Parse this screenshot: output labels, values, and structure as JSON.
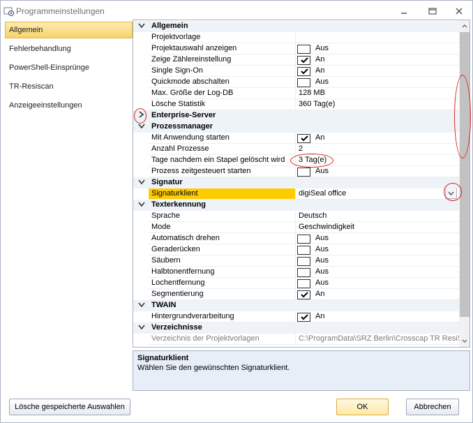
{
  "window": {
    "title": "Programmeinstellungen",
    "minimize_icon": "minimize-icon",
    "maximize_icon": "maximize-icon",
    "close_icon": "close-icon"
  },
  "nav": {
    "items": [
      {
        "label": "Allgemein",
        "active": true
      },
      {
        "label": "Fehlerbehandlung",
        "active": false
      },
      {
        "label": "PowerShell-Einsprünge",
        "active": false
      },
      {
        "label": "TR-Resiscan",
        "active": false
      },
      {
        "label": "Anzeigeeinstellungen",
        "active": false
      }
    ]
  },
  "grid": {
    "rows": [
      {
        "type": "cat",
        "label": "Allgemein",
        "expanded": true
      },
      {
        "type": "text",
        "name": "Projektvorlage",
        "value": ""
      },
      {
        "type": "check",
        "name": "Projektauswahl anzeigen",
        "checked": false,
        "value": "Aus"
      },
      {
        "type": "check",
        "name": "Zeige Zählereinstellung",
        "checked": true,
        "value": "An"
      },
      {
        "type": "check",
        "name": "Single Sign-On",
        "checked": true,
        "value": "An"
      },
      {
        "type": "check",
        "name": "Quickmode abschalten",
        "checked": false,
        "value": "Aus"
      },
      {
        "type": "text",
        "name": "Max. Größe der Log-DB",
        "value": "128 MB"
      },
      {
        "type": "text",
        "name": "Lösche Statistik",
        "value": "360 Tag(e)"
      },
      {
        "type": "cat",
        "label": "Enterprise-Server",
        "expanded": false
      },
      {
        "type": "cat",
        "label": "Prozessmanager",
        "expanded": true
      },
      {
        "type": "check",
        "name": "Mit Anwendung starten",
        "checked": true,
        "value": "An"
      },
      {
        "type": "text",
        "name": "Anzahl Prozesse",
        "value": "2"
      },
      {
        "type": "text",
        "name": "Tage nachdem ein Stapel gelöscht wird",
        "value": "3 Tag(e)"
      },
      {
        "type": "check",
        "name": "Prozess zeitgesteuert starten",
        "checked": false,
        "value": "Aus"
      },
      {
        "type": "cat",
        "label": "Signatur",
        "expanded": true
      },
      {
        "type": "dropdown",
        "name": "Signaturklient",
        "value": "digiSeal office",
        "selected": true
      },
      {
        "type": "cat",
        "label": "Texterkennung",
        "expanded": true
      },
      {
        "type": "text",
        "name": "Sprache",
        "value": "Deutsch"
      },
      {
        "type": "text",
        "name": "Mode",
        "value": "Geschwindigkeit"
      },
      {
        "type": "check",
        "name": "Automatisch drehen",
        "checked": false,
        "value": "Aus"
      },
      {
        "type": "check",
        "name": "Geraderücken",
        "checked": false,
        "value": "Aus"
      },
      {
        "type": "check",
        "name": "Säubern",
        "checked": false,
        "value": "Aus"
      },
      {
        "type": "check",
        "name": "Halbtonentfernung",
        "checked": false,
        "value": "Aus"
      },
      {
        "type": "check",
        "name": "Lochentfernung",
        "checked": false,
        "value": "Aus"
      },
      {
        "type": "check",
        "name": "Segmentierung",
        "checked": true,
        "value": "An"
      },
      {
        "type": "cat",
        "label": "TWAIN",
        "expanded": true
      },
      {
        "type": "check",
        "name": "Hintergrundverarbeitung",
        "checked": true,
        "value": "An"
      },
      {
        "type": "cat",
        "label": "Verzeichnisse",
        "expanded": true
      },
      {
        "type": "text",
        "name": "Verzeichnis der Projektvorlagen",
        "value": "C:\\ProgramData\\SRZ Berlin\\Crosscap TR ResiS",
        "disabled": true
      }
    ]
  },
  "help": {
    "title": "Signaturklient",
    "description": "Wählen Sie den gewünschten Signaturklient."
  },
  "buttons": {
    "clear_selections": "Lösche gespeicherte Auswahlen",
    "ok": "OK",
    "cancel": "Abbrechen"
  },
  "colors": {
    "selection": "#ffcc00",
    "category_bg": "#eef3f8",
    "help_bg": "#e7eef7",
    "annotation": "#dd2222"
  }
}
